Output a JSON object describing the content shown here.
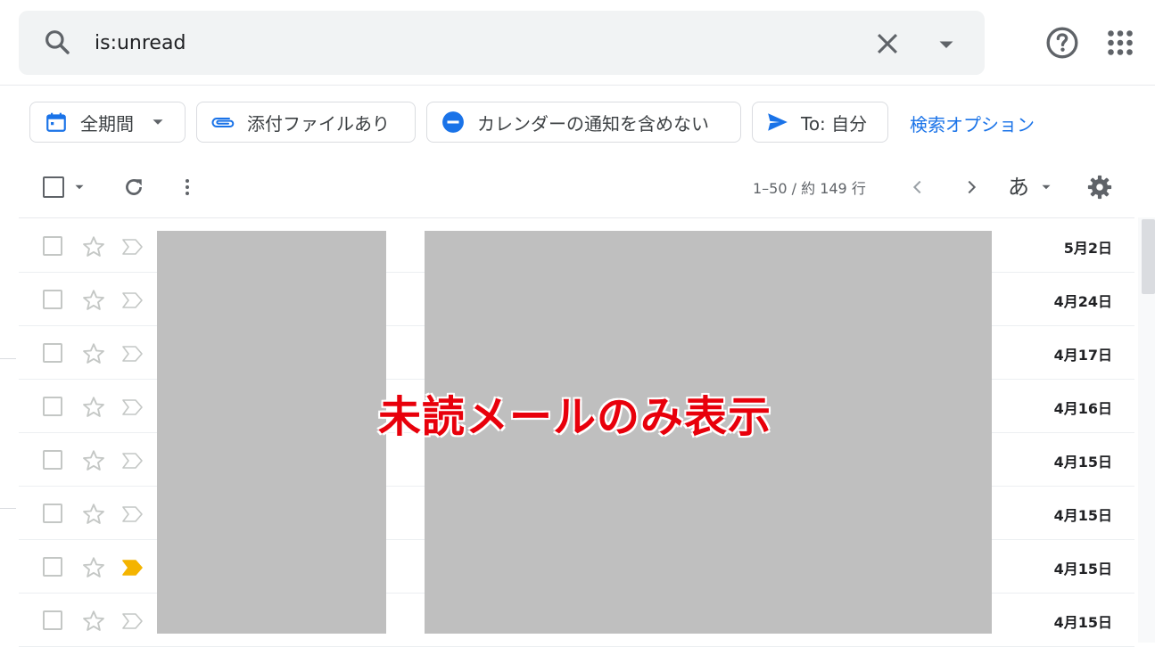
{
  "search": {
    "query": "is:unread",
    "icon": "search-icon"
  },
  "header_icons": [
    "close-icon",
    "dropdown-arrow-icon",
    "help-icon",
    "apps-grid-icon"
  ],
  "chips": [
    {
      "label": "全期間",
      "icon": "calendar-icon",
      "icon_color": "#1a73e8"
    },
    {
      "label": "添付ファイルあり",
      "icon": "paperclip-icon",
      "icon_color": "#1a73e8"
    },
    {
      "label": "カレンダーの通知を含めない",
      "icon": "minus-circle-icon",
      "icon_color": "#1a73e8"
    },
    {
      "label_prefix": "To:",
      "label": " 自分",
      "icon": "send-icon",
      "icon_color": "#1a73e8"
    }
  ],
  "advanced_search_link": "検索オプション",
  "toolbar": {
    "pager": "1–50 / 約 149 行",
    "input_tool": "あ"
  },
  "rows": [
    {
      "date": "5月2日",
      "important": false
    },
    {
      "date": "4月24日",
      "important": false
    },
    {
      "date": "4月17日",
      "important": false
    },
    {
      "date": "4月16日",
      "important": false
    },
    {
      "date": "4月15日",
      "important": false
    },
    {
      "date": "4月15日",
      "important": false
    },
    {
      "date": "4月15日",
      "important": true
    },
    {
      "date": "4月15日",
      "important": false
    }
  ],
  "overlay_caption": "未読メールのみ表示",
  "colors": {
    "accent": "#1a73e8",
    "caption": "#e8000b",
    "important_marker": "#f4b400",
    "redaction": "#bfbfbf"
  }
}
